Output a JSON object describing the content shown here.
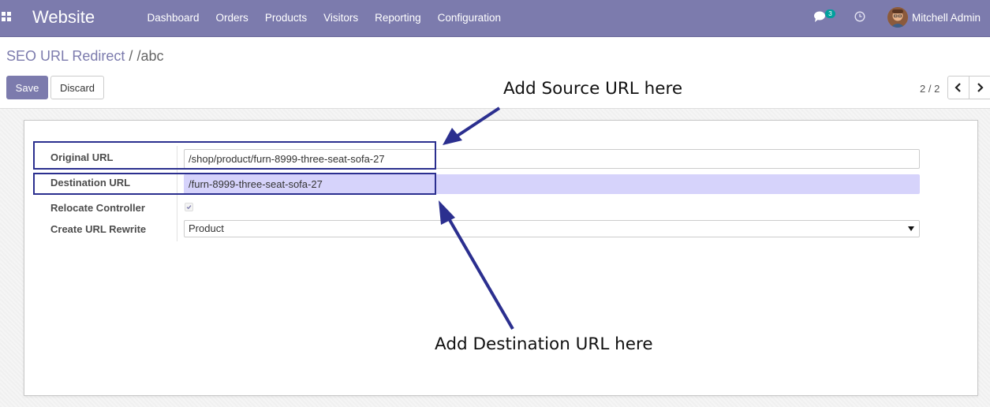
{
  "navbar": {
    "app_name": "Website",
    "menu": [
      "Dashboard",
      "Orders",
      "Products",
      "Visitors",
      "Reporting",
      "Configuration"
    ],
    "chat_count": "3",
    "user_name": "Mitchell Admin"
  },
  "breadcrumb": {
    "parent": "SEO URL Redirect",
    "separator": "/",
    "current": "/abc"
  },
  "buttons": {
    "save": "Save",
    "discard": "Discard"
  },
  "pager": {
    "value": "2 / 2"
  },
  "form": {
    "original_url_label": "Original URL",
    "original_url_value": "/shop/product/furn-8999-three-seat-sofa-27",
    "destination_url_label": "Destination URL",
    "destination_url_value": "/furn-8999-three-seat-sofa-27",
    "relocate_controller_label": "Relocate Controller",
    "relocate_controller_checked": true,
    "create_url_rewrite_label": "Create URL Rewrite",
    "create_url_rewrite_value": "Product"
  },
  "annotations": {
    "source_note": "Add Source URL here",
    "destination_note": "Add Destination URL here"
  },
  "colors": {
    "navbar": "#7c7bad",
    "primary": "#7c7bad",
    "focused_input": "#d6d3fb",
    "annotation": "#2b2f8f"
  },
  "icons": [
    "apps-grid-icon",
    "chat-icon",
    "clock-icon",
    "chevron-left-icon",
    "chevron-right-icon",
    "checkmark-icon",
    "caret-down-icon"
  ]
}
